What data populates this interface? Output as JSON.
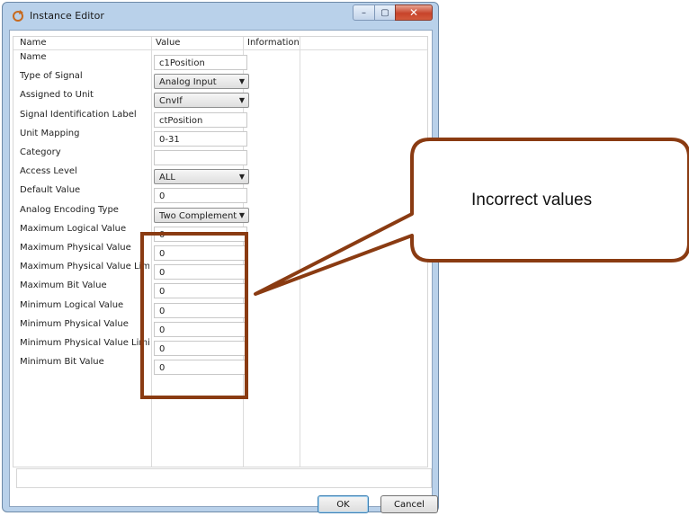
{
  "window": {
    "title": "Instance Editor",
    "controls": {
      "minimize": "–",
      "maximize": "▢",
      "close": "✕"
    }
  },
  "grid": {
    "columns": [
      "Name",
      "Value",
      "Information"
    ],
    "rows": [
      {
        "label": "Name",
        "value": "c1Position",
        "type": "input"
      },
      {
        "label": "Type of Signal",
        "value": "Analog Input",
        "type": "select"
      },
      {
        "label": "Assigned to Unit",
        "value": "CnvIf",
        "type": "select"
      },
      {
        "label": "Signal Identification Label",
        "value": "ctPosition",
        "type": "input"
      },
      {
        "label": "Unit Mapping",
        "value": "0-31",
        "type": "input"
      },
      {
        "label": "Category",
        "value": "",
        "type": "input"
      },
      {
        "label": "Access Level",
        "value": "ALL",
        "type": "select"
      },
      {
        "label": "Default Value",
        "value": "0",
        "type": "input"
      },
      {
        "label": "Analog Encoding Type",
        "value": "Two Complement",
        "type": "select"
      },
      {
        "label": "Maximum Logical Value",
        "value": "0",
        "type": "input"
      },
      {
        "label": "Maximum Physical Value",
        "value": "0",
        "type": "input"
      },
      {
        "label": "Maximum Physical Value Limit",
        "value": "0",
        "type": "input"
      },
      {
        "label": "Maximum Bit Value",
        "value": "0",
        "type": "input"
      },
      {
        "label": "Minimum Logical Value",
        "value": "0",
        "type": "input"
      },
      {
        "label": "Minimum Physical Value",
        "value": "0",
        "type": "input"
      },
      {
        "label": "Minimum Physical Value Limit",
        "value": "0",
        "type": "input"
      },
      {
        "label": "Minimum Bit Value",
        "value": "0",
        "type": "input"
      }
    ]
  },
  "buttons": {
    "ok": "OK",
    "cancel": "Cancel"
  },
  "annotation": {
    "text": "Incorrect values",
    "color": "#8a3b12"
  }
}
